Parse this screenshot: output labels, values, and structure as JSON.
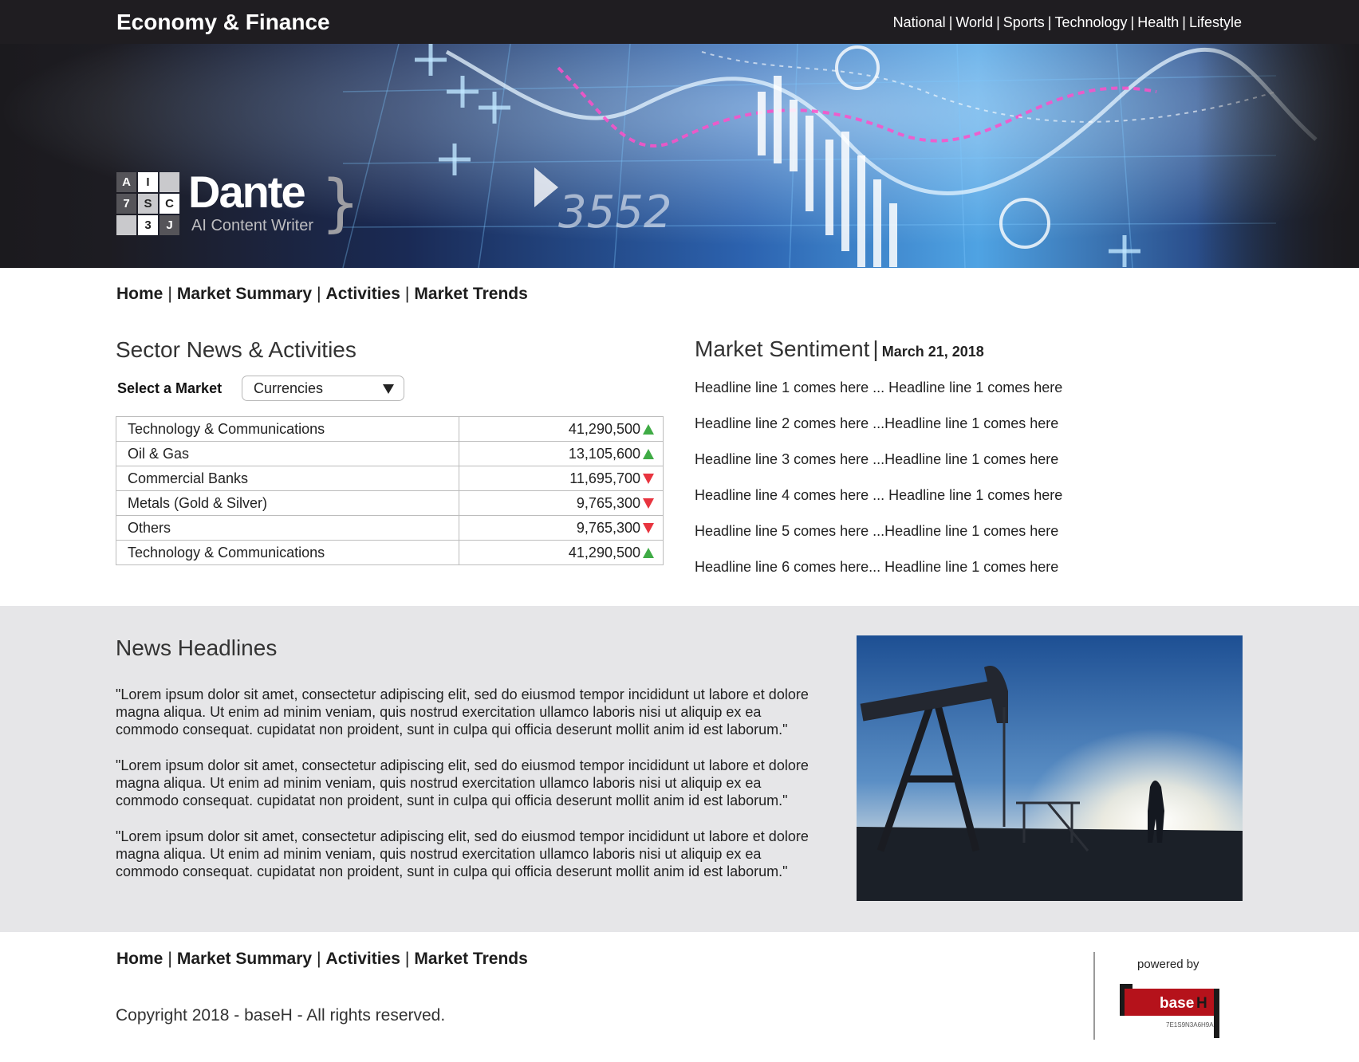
{
  "header": {
    "site_title": "Economy & Finance",
    "top_nav": [
      "National",
      "World",
      "Sports",
      "Technology",
      "Health",
      "Lifestyle"
    ],
    "separator": "|"
  },
  "hero": {
    "ticker_number": "3552"
  },
  "logo": {
    "grid": [
      [
        "A",
        "I",
        ""
      ],
      [
        "7",
        "S",
        "C"
      ],
      [
        "",
        "3",
        "J"
      ]
    ],
    "name": "Dante",
    "subtitle": "AI Content Writer",
    "brace": "}"
  },
  "main_nav": [
    "Home",
    "Market Summary",
    "Activities",
    "Market Trends"
  ],
  "sector": {
    "title": "Sector News & Activities",
    "select_label": "Select a Market",
    "select_value": "Currencies",
    "rows": [
      {
        "name": "Technology & Communications",
        "value": "41,290,500",
        "trend": "up"
      },
      {
        "name": "Oil & Gas",
        "value": "13,105,600",
        "trend": "up"
      },
      {
        "name": "Commercial Banks",
        "value": "11,695,700",
        "trend": "down"
      },
      {
        "name": "Metals (Gold & Silver)",
        "value": "9,765,300",
        "trend": "down"
      },
      {
        "name": "Others",
        "value": "9,765,300",
        "trend": "down"
      },
      {
        "name": "Technology & Communications",
        "value": "41,290,500",
        "trend": "up"
      }
    ],
    "trend_colors": {
      "up": "#3fab45",
      "down": "#e8343f"
    }
  },
  "sentiment": {
    "title": "Market Sentiment",
    "separator": "|",
    "date": "March 21, 2018",
    "headlines": [
      "Headline line 1 comes here ... Headline line 1 comes here",
      "Headline line 2 comes here ...Headline line 1 comes here",
      "Headline line 3 comes here ...Headline line 1 comes here",
      "Headline line 4 comes here ... Headline line 1 comes here",
      "Headline line 5 comes here ...Headline line 1 comes here",
      "Headline line 6 comes here... Headline line 1 comes here"
    ]
  },
  "news": {
    "title": "News Headlines",
    "paragraphs": [
      "\"Lorem ipsum dolor sit amet, consectetur adipiscing elit, sed do eiusmod tempor incididunt ut labore et dolore magna aliqua. Ut enim ad minim veniam, quis nostrud exercitation ullamco laboris nisi ut aliquip ex ea commodo consequat. cupidatat non proident, sunt in culpa qui officia deserunt mollit anim id est laborum.\"",
      "\"Lorem ipsum dolor sit amet, consectetur adipiscing elit, sed do eiusmod tempor incididunt ut labore et dolore magna aliqua. Ut enim ad minim veniam, quis nostrud exercitation ullamco laboris nisi ut aliquip ex ea commodo consequat. cupidatat non proident, sunt in culpa qui officia deserunt mollit anim id est laborum.\"",
      "\"Lorem ipsum dolor sit amet, consectetur adipiscing elit, sed do eiusmod tempor incididunt ut labore et dolore magna aliqua. Ut enim ad minim veniam, quis nostrud exercitation ullamco laboris nisi ut aliquip ex ea commodo consequat. cupidatat non proident, sunt in culpa qui officia deserunt mollit anim id est laborum.\""
    ],
    "photo_icon": "oil-pump-photo"
  },
  "footer": {
    "nav": [
      "Home",
      "Market Summary",
      "Activities",
      "Market Trends"
    ],
    "copyright": "Copyright 2018 - baseH - All rights reserved.",
    "powered_by": "powered by",
    "brand": "base",
    "brand_accent": "H",
    "brand_code": "7E1S9N3A6H9A",
    "brand_color": "#b5121b"
  }
}
